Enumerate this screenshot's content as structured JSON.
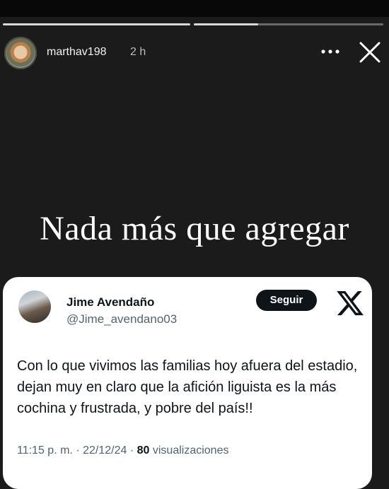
{
  "story": {
    "username": "marthav198",
    "time_ago": "2 h",
    "caption": "Nada más que agregar",
    "progress": [
      1.0,
      0.34
    ]
  },
  "icons": {
    "more": "more-options-icon",
    "close": "close-icon",
    "x_logo": "x-logo-icon"
  },
  "tweet": {
    "display_name": "Jime Avendaño",
    "handle": "@Jime_avendano03",
    "follow_label": "Seguir",
    "text": "Con lo que vivimos las familias hoy afuera del estadio, dejan muy en claro que la afición liguista es la más cochina y frustrada, y pobre del país!!",
    "time": "11:15 p. m.",
    "separator": "·",
    "date": "22/12/24",
    "views_count": "80",
    "views_label": "visualizaciones"
  }
}
